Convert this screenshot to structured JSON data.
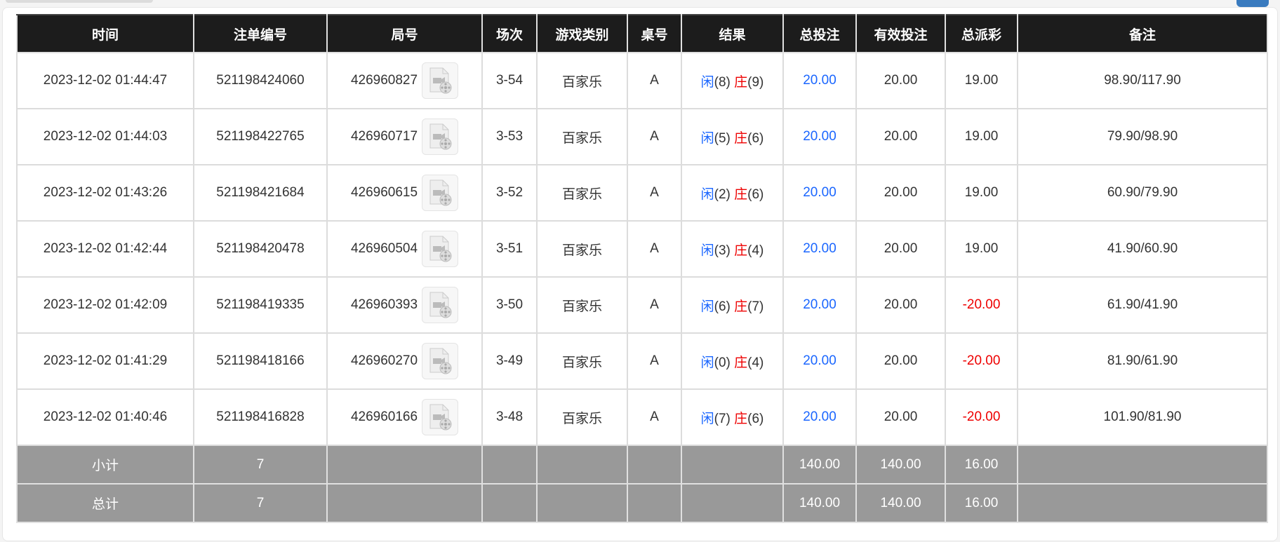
{
  "colors": {
    "header_bg": "#1c1c1c",
    "blue": "#1a66ff",
    "red": "#ee0000",
    "footer_bg": "#999999"
  },
  "columns": [
    "时间",
    "注单编号",
    "局号",
    "场次",
    "游戏类别",
    "桌号",
    "结果",
    "总投注",
    "有效投注",
    "总派彩",
    "备注"
  ],
  "rows": [
    {
      "time": "2023-12-02 01:44:47",
      "bet_id": "521198424060",
      "round": "426960827",
      "session": "3-54",
      "game": "百家乐",
      "table": "A",
      "player_label": "闲",
      "player": "(8)",
      "banker_label": "庄",
      "banker": "(9)",
      "total_bet": "20.00",
      "valid_bet": "20.00",
      "payout": "19.00",
      "payout_negative": false,
      "note": "98.90/117.90"
    },
    {
      "time": "2023-12-02 01:44:03",
      "bet_id": "521198422765",
      "round": "426960717",
      "session": "3-53",
      "game": "百家乐",
      "table": "A",
      "player_label": "闲",
      "player": "(5)",
      "banker_label": "庄",
      "banker": "(6)",
      "total_bet": "20.00",
      "valid_bet": "20.00",
      "payout": "19.00",
      "payout_negative": false,
      "note": "79.90/98.90"
    },
    {
      "time": "2023-12-02 01:43:26",
      "bet_id": "521198421684",
      "round": "426960615",
      "session": "3-52",
      "game": "百家乐",
      "table": "A",
      "player_label": "闲",
      "player": "(2)",
      "banker_label": "庄",
      "banker": "(6)",
      "total_bet": "20.00",
      "valid_bet": "20.00",
      "payout": "19.00",
      "payout_negative": false,
      "note": "60.90/79.90"
    },
    {
      "time": "2023-12-02 01:42:44",
      "bet_id": "521198420478",
      "round": "426960504",
      "session": "3-51",
      "game": "百家乐",
      "table": "A",
      "player_label": "闲",
      "player": "(3)",
      "banker_label": "庄",
      "banker": "(4)",
      "total_bet": "20.00",
      "valid_bet": "20.00",
      "payout": "19.00",
      "payout_negative": false,
      "note": "41.90/60.90"
    },
    {
      "time": "2023-12-02 01:42:09",
      "bet_id": "521198419335",
      "round": "426960393",
      "session": "3-50",
      "game": "百家乐",
      "table": "A",
      "player_label": "闲",
      "player": "(6)",
      "banker_label": "庄",
      "banker": "(7)",
      "total_bet": "20.00",
      "valid_bet": "20.00",
      "payout": "-20.00",
      "payout_negative": true,
      "note": "61.90/41.90"
    },
    {
      "time": "2023-12-02 01:41:29",
      "bet_id": "521198418166",
      "round": "426960270",
      "session": "3-49",
      "game": "百家乐",
      "table": "A",
      "player_label": "闲",
      "player": "(0)",
      "banker_label": "庄",
      "banker": "(4)",
      "total_bet": "20.00",
      "valid_bet": "20.00",
      "payout": "-20.00",
      "payout_negative": true,
      "note": "81.90/61.90"
    },
    {
      "time": "2023-12-02 01:40:46",
      "bet_id": "521198416828",
      "round": "426960166",
      "session": "3-48",
      "game": "百家乐",
      "table": "A",
      "player_label": "闲",
      "player": "(7)",
      "banker_label": "庄",
      "banker": "(6)",
      "total_bet": "20.00",
      "valid_bet": "20.00",
      "payout": "-20.00",
      "payout_negative": true,
      "note": "101.90/81.90"
    }
  ],
  "icons": {
    "replay": "video-file-icon"
  },
  "subtotal": {
    "label": "小计",
    "count": "7",
    "total_bet": "140.00",
    "valid_bet": "140.00",
    "payout": "16.00"
  },
  "total": {
    "label": "总计",
    "count": "7",
    "total_bet": "140.00",
    "valid_bet": "140.00",
    "payout": "16.00"
  }
}
